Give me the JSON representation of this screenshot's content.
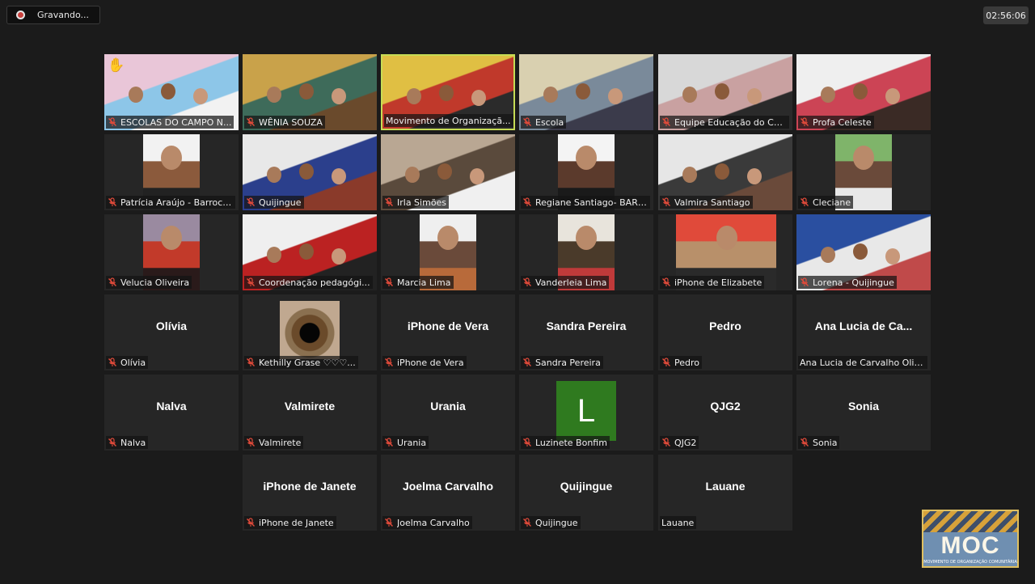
{
  "recording": {
    "label": "Gravando..."
  },
  "timer": {
    "value": "02:56:06"
  },
  "participants": [
    {
      "label": "ESCOLAS DO CAMPO N...",
      "video": true,
      "muted": true,
      "hand_raised": true,
      "colors": [
        "#e9c6d8",
        "#8dc6e8",
        "#f2f2f2"
      ]
    },
    {
      "label": "WÊNIA SOUZA",
      "video": true,
      "muted": true,
      "colors": [
        "#c9a24a",
        "#3e6b5a",
        "#6a4a2c"
      ]
    },
    {
      "label": "Movimento de Organizaçã...",
      "video": true,
      "muted": false,
      "active_speaker": true,
      "colors": [
        "#e0bf43",
        "#c0392b",
        "#2b2b2b"
      ]
    },
    {
      "label": "Escola",
      "video": true,
      "muted": true,
      "colors": [
        "#d9d0b0",
        "#7a8a9a",
        "#3b3b4b"
      ]
    },
    {
      "label": "Equipe Educação do Ca...",
      "video": true,
      "muted": true,
      "colors": [
        "#d8d8d8",
        "#c9a1a1",
        "#2a2a2a"
      ]
    },
    {
      "label": "Profa Celeste",
      "video": true,
      "muted": true,
      "colors": [
        "#efefef",
        "#c45",
        "#3a2a25"
      ]
    },
    {
      "label": "Patrícia Araújo - Barroca...",
      "video": true,
      "muted": true,
      "colors": [
        "#f2f2f2",
        "#8b5a3c",
        "#222"
      ]
    },
    {
      "label": "Quijingue",
      "video": true,
      "muted": true,
      "colors": [
        "#e8e8e8",
        "#2b3f8c",
        "#8a3a2a"
      ]
    },
    {
      "label": "Irla Simões",
      "video": true,
      "muted": true,
      "colors": [
        "#b9a793",
        "#5a4a3c",
        "#f0f0f0"
      ]
    },
    {
      "label": "Regiane Santiago- BARR...",
      "video": true,
      "muted": true,
      "colors": [
        "#f4f4f4",
        "#5b3a2c",
        "#1a1a1a"
      ]
    },
    {
      "label": "Valmira Santiago",
      "video": true,
      "muted": true,
      "colors": [
        "#e6e6e6",
        "#3a3a3a",
        "#6a4a3a"
      ]
    },
    {
      "label": "Cleciane",
      "video": true,
      "muted": true,
      "colors": [
        "#7fb46a",
        "#6a4a3a",
        "#e8e8e8"
      ]
    },
    {
      "label": "Velucia Oliveira",
      "video": true,
      "muted": true,
      "colors": [
        "#9a8aa0",
        "#c23a2a",
        "#2a1a1a"
      ]
    },
    {
      "label": "Coordenação pedagógi...",
      "video": true,
      "muted": true,
      "colors": [
        "#efefef",
        "#b22",
        "#222"
      ]
    },
    {
      "label": "Marcia Lima",
      "video": true,
      "muted": true,
      "colors": [
        "#efefef",
        "#6a4a3a",
        "#b86a3a"
      ]
    },
    {
      "label": "Vanderleia Lima",
      "video": true,
      "muted": true,
      "colors": [
        "#e8e4dc",
        "#4a3a2a",
        "#c03a3a"
      ]
    },
    {
      "label": "iPhone de Elizabete",
      "video": true,
      "muted": true,
      "colors": [
        "#e04a3a",
        "#b8906a",
        "#2a2a2a"
      ]
    },
    {
      "label": "Lorena - Quijingue",
      "video": true,
      "muted": true,
      "colors": [
        "#2a4fa0",
        "#e8e8e8",
        "#c04a4a"
      ]
    },
    {
      "label": "Olívia",
      "display_name": "Olívia",
      "video": false,
      "muted": true
    },
    {
      "label": "Kethilly Grase ♡♡♡...",
      "video": true,
      "muted": true,
      "eye_picture": true,
      "colors": [
        "#7a5a3a",
        "#1a1a1a",
        "#a08060"
      ]
    },
    {
      "label": "iPhone de Vera",
      "display_name": "iPhone de Vera",
      "video": false,
      "muted": true
    },
    {
      "label": "Sandra Pereira",
      "display_name": "Sandra Pereira",
      "video": false,
      "muted": true
    },
    {
      "label": "Pedro",
      "display_name": "Pedro",
      "video": false,
      "muted": true
    },
    {
      "label": "Ana Lucia de Carvalho Oliv...",
      "display_name": "Ana Lucia de Ca...",
      "video": false,
      "muted": false
    },
    {
      "label": "Nalva",
      "display_name": "Nalva",
      "video": false,
      "muted": true
    },
    {
      "label": "Valmirete",
      "display_name": "Valmirete",
      "video": false,
      "muted": true
    },
    {
      "label": "Urania",
      "display_name": "Urania",
      "video": false,
      "muted": true
    },
    {
      "label": "Luzinete Bonfim",
      "avatar_letter": "L",
      "avatar_color": "#2f7a1f",
      "video": false,
      "muted": true
    },
    {
      "label": "QJG2",
      "display_name": "QJG2",
      "video": false,
      "muted": true
    },
    {
      "label": "Sonia",
      "display_name": "Sonia",
      "video": false,
      "muted": true
    },
    {
      "label": "iPhone de Janete",
      "display_name": "iPhone de Janete",
      "video": false,
      "muted": true
    },
    {
      "label": "Joelma Carvalho",
      "display_name": "Joelma Carvalho",
      "video": false,
      "muted": true
    },
    {
      "label": "Quijingue",
      "display_name": "Quijingue",
      "video": false,
      "muted": true
    },
    {
      "label": "Lauane",
      "display_name": "Lauane",
      "video": false,
      "muted": false
    }
  ],
  "watermark": {
    "text": "MOC",
    "subtext": "MOVIMENTO DE ORGANIZAÇÃO COMUNITÁRIA"
  },
  "colors": {
    "background": "#1b1b1b",
    "tile": "#262626",
    "active_border": "#c6dc55",
    "mute_icon": "#e04a3a"
  }
}
